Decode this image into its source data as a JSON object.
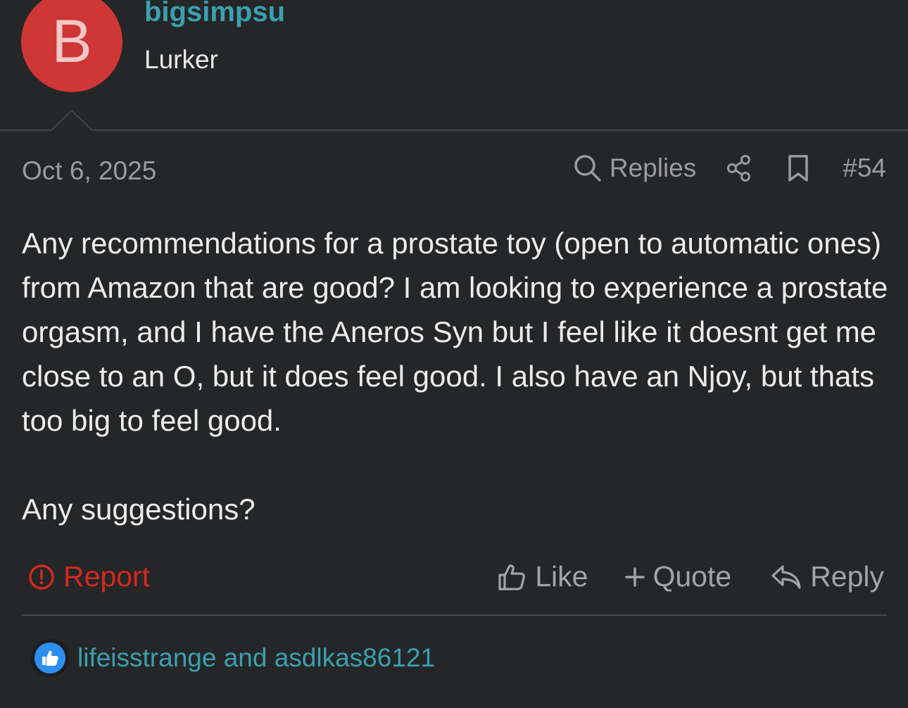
{
  "colors": {
    "accent": "#3aa0b0",
    "avatar_bg": "#cf3636",
    "report": "#d4281f",
    "like_badge": "#2d8ff0"
  },
  "author": {
    "avatar_letter": "B",
    "username": "bigsimpsu",
    "title": "Lurker"
  },
  "post": {
    "date": "Oct 6, 2025",
    "replies_label": "Replies",
    "number": "#54",
    "body": [
      "Any recommendations for a prostate toy (open to automatic ones) from Amazon that are good? I am looking to experience a prostate orgasm, and I have the Aneros Syn but I feel like it doesnt get me close to an O, but it does feel good. I also have an Njoy, but thats too big to feel good.",
      "Any suggestions?"
    ]
  },
  "actions": {
    "report": "Report",
    "like": "Like",
    "quote": "Quote",
    "reply": "Reply"
  },
  "reactions": {
    "users_text": "lifeisstrange and asdlkas86121"
  },
  "icons": {
    "replies": "search-icon",
    "share": "share-icon",
    "bookmark": "bookmark-icon",
    "report": "alert-circle-icon",
    "like": "thumbs-up-icon",
    "quote": "plus-icon",
    "reply": "reply-arrow-icon",
    "reaction": "like-reaction-icon"
  }
}
